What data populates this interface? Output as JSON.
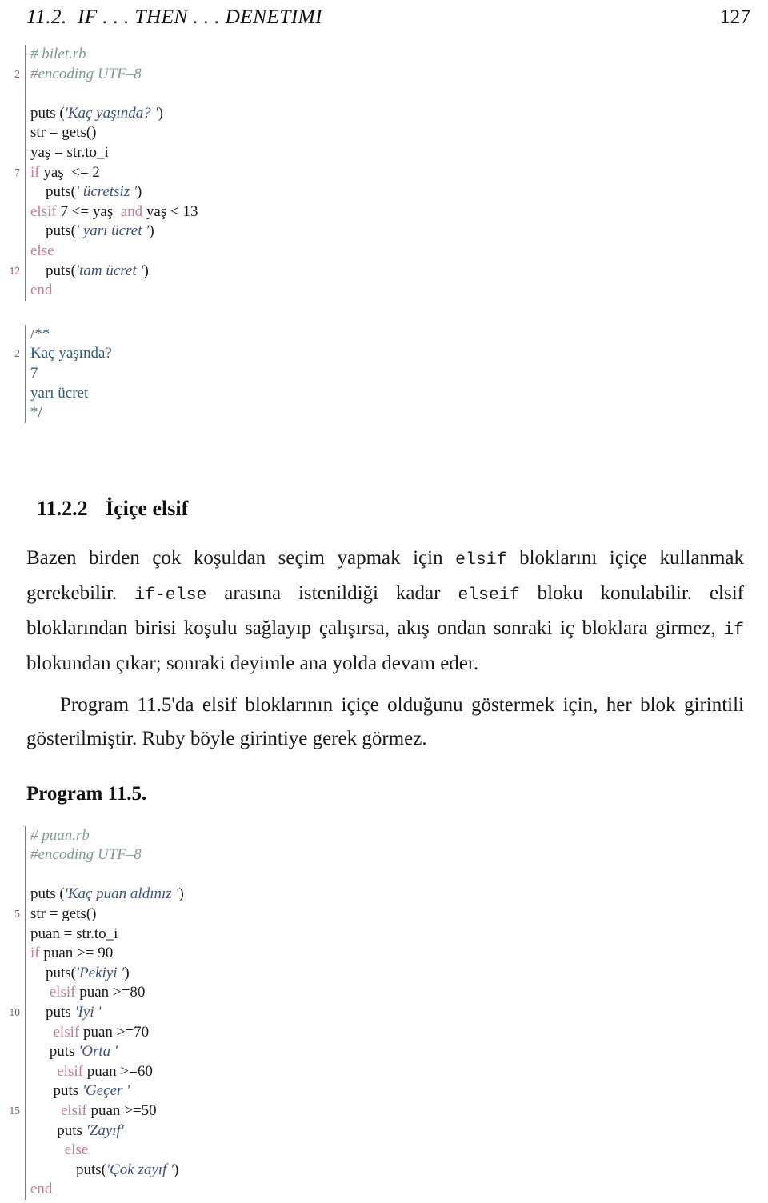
{
  "header": {
    "title": "11.2.  IF . . . THEN . . . DENETIMI",
    "page_number": "127"
  },
  "listing1": {
    "name": "bilet-rb-listing",
    "lines": [
      {
        "no": "",
        "segments": [
          {
            "t": "# bilet.rb",
            "c": "cmt",
            "indent": 0
          }
        ]
      },
      {
        "no": "2",
        "segments": [
          {
            "t": "#encoding UTF–8",
            "c": "cmt",
            "indent": 0
          }
        ]
      },
      {
        "no": "",
        "segments": [
          {
            "t": "",
            "c": "plain",
            "indent": 0
          }
        ]
      },
      {
        "no": "",
        "segments": [
          {
            "t": "puts (",
            "c": "plain",
            "indent": 0
          },
          {
            "t": "'Kaç yaşında? '",
            "c": "str",
            "indent": 0
          },
          {
            "t": ")",
            "c": "plain",
            "indent": 0
          }
        ]
      },
      {
        "no": "",
        "segments": [
          {
            "t": "str = gets()",
            "c": "plain",
            "indent": 0
          }
        ]
      },
      {
        "no": "",
        "segments": [
          {
            "t": "yaş = str.to_i",
            "c": "plain",
            "indent": 0
          }
        ]
      },
      {
        "no": "7",
        "segments": [
          {
            "t": "if",
            "c": "kw",
            "indent": 0
          },
          {
            "t": " yaş  <= 2",
            "c": "plain",
            "indent": 0
          }
        ]
      },
      {
        "no": "",
        "segments": [
          {
            "t": "    puts(",
            "c": "plain",
            "indent": 0
          },
          {
            "t": "' ücretsiz '",
            "c": "str",
            "indent": 0
          },
          {
            "t": ")",
            "c": "plain",
            "indent": 0
          }
        ]
      },
      {
        "no": "",
        "segments": [
          {
            "t": "elsif",
            "c": "kw",
            "indent": 0
          },
          {
            "t": " 7 <= yaş  ",
            "c": "plain",
            "indent": 0
          },
          {
            "t": "and",
            "c": "kw",
            "indent": 0
          },
          {
            "t": " yaş < 13",
            "c": "plain",
            "indent": 0
          }
        ]
      },
      {
        "no": "",
        "segments": [
          {
            "t": "    puts(",
            "c": "plain",
            "indent": 0
          },
          {
            "t": "' yarı ücret '",
            "c": "str",
            "indent": 0
          },
          {
            "t": ")",
            "c": "plain",
            "indent": 0
          }
        ]
      },
      {
        "no": "",
        "segments": [
          {
            "t": "else",
            "c": "kw",
            "indent": 0
          }
        ]
      },
      {
        "no": "12",
        "segments": [
          {
            "t": "    puts(",
            "c": "plain",
            "indent": 0
          },
          {
            "t": "'tam ücret '",
            "c": "str",
            "indent": 0
          },
          {
            "t": ")",
            "c": "plain",
            "indent": 0
          }
        ]
      },
      {
        "no": "",
        "segments": [
          {
            "t": "end",
            "c": "kw",
            "indent": 0
          }
        ]
      }
    ]
  },
  "listing2": {
    "name": "sample-output-listing",
    "lines": [
      {
        "no": "",
        "segments": [
          {
            "t": "/**",
            "c": "out",
            "indent": 0
          }
        ]
      },
      {
        "no": "2",
        "segments": [
          {
            "t": "Kaç yaşında?",
            "c": "out",
            "indent": 0
          }
        ]
      },
      {
        "no": "",
        "segments": [
          {
            "t": "7",
            "c": "out",
            "indent": 0
          }
        ]
      },
      {
        "no": "",
        "segments": [
          {
            "t": "yarı ücret",
            "c": "out",
            "indent": 0
          }
        ]
      },
      {
        "no": "",
        "segments": [
          {
            "t": "*/",
            "c": "out",
            "indent": 0
          }
        ]
      }
    ]
  },
  "section": {
    "number": "11.2.2",
    "title": "İçiçe elsif"
  },
  "paragraph1": {
    "part1": "Bazen birden çok koşuldan seçim yapmak için ",
    "code1": "elsif",
    "part2": " bloklarını içiçe kullanmak gerekebilir. ",
    "code2": "if-else",
    "part3": " arasına istenildiği kadar ",
    "code3": "elseif",
    "part4": " bloku konulabilir. elsif bloklarından birisi koşulu sağlayıp çalışırsa, akış ondan sonraki iç bloklara girmez, ",
    "code4": "if",
    "part5": " blokundan çıkar; sonraki deyimle ana yolda devam eder."
  },
  "paragraph2": {
    "text": "Program 11.5'da elsif bloklarının içiçe olduğunu göstermek için, her blok girintili gösterilmiştir. Ruby böyle girintiye gerek görmez."
  },
  "program_label": "Program 11.5.",
  "listing3": {
    "name": "puan-rb-listing",
    "lines": [
      {
        "no": "",
        "segments": [
          {
            "t": "# puan.rb",
            "c": "cmt",
            "indent": 0
          }
        ]
      },
      {
        "no": "",
        "segments": [
          {
            "t": "#encoding UTF–8",
            "c": "cmt",
            "indent": 0
          }
        ]
      },
      {
        "no": "",
        "segments": [
          {
            "t": "",
            "c": "plain",
            "indent": 0
          }
        ]
      },
      {
        "no": "",
        "segments": [
          {
            "t": "puts (",
            "c": "plain",
            "indent": 0
          },
          {
            "t": "'Kaç puan aldınız '",
            "c": "str",
            "indent": 0
          },
          {
            "t": ")",
            "c": "plain",
            "indent": 0
          }
        ]
      },
      {
        "no": "5",
        "segments": [
          {
            "t": "str = gets()",
            "c": "plain",
            "indent": 0
          }
        ]
      },
      {
        "no": "",
        "segments": [
          {
            "t": "puan = str.to_i",
            "c": "plain",
            "indent": 0
          }
        ]
      },
      {
        "no": "",
        "segments": [
          {
            "t": "if",
            "c": "kw",
            "indent": 0
          },
          {
            "t": " puan >= 90",
            "c": "plain",
            "indent": 0
          }
        ]
      },
      {
        "no": "",
        "segments": [
          {
            "t": "    puts(",
            "c": "plain",
            "indent": 0
          },
          {
            "t": "'Pekiyi '",
            "c": "str",
            "indent": 0
          },
          {
            "t": ")",
            "c": "plain",
            "indent": 0
          }
        ]
      },
      {
        "no": "",
        "segments": [
          {
            "t": "     ",
            "c": "plain",
            "indent": 0
          },
          {
            "t": "elsif",
            "c": "kw",
            "indent": 0
          },
          {
            "t": " puan >=80",
            "c": "plain",
            "indent": 0
          }
        ]
      },
      {
        "no": "10",
        "segments": [
          {
            "t": "    puts ",
            "c": "plain",
            "indent": 0
          },
          {
            "t": "'İyi '",
            "c": "str",
            "indent": 0
          }
        ]
      },
      {
        "no": "",
        "segments": [
          {
            "t": "      ",
            "c": "plain",
            "indent": 0
          },
          {
            "t": "elsif",
            "c": "kw",
            "indent": 0
          },
          {
            "t": " puan >=70",
            "c": "plain",
            "indent": 0
          }
        ]
      },
      {
        "no": "",
        "segments": [
          {
            "t": "     puts ",
            "c": "plain",
            "indent": 0
          },
          {
            "t": "'Orta '",
            "c": "str",
            "indent": 0
          }
        ]
      },
      {
        "no": "",
        "segments": [
          {
            "t": "       ",
            "c": "plain",
            "indent": 0
          },
          {
            "t": "elsif",
            "c": "kw",
            "indent": 0
          },
          {
            "t": " puan >=60",
            "c": "plain",
            "indent": 0
          }
        ]
      },
      {
        "no": "",
        "segments": [
          {
            "t": "      puts ",
            "c": "plain",
            "indent": 0
          },
          {
            "t": "'Geçer '",
            "c": "str",
            "indent": 0
          }
        ]
      },
      {
        "no": "15",
        "segments": [
          {
            "t": "        ",
            "c": "plain",
            "indent": 0
          },
          {
            "t": "elsif",
            "c": "kw",
            "indent": 0
          },
          {
            "t": " puan >=50",
            "c": "plain",
            "indent": 0
          }
        ]
      },
      {
        "no": "",
        "segments": [
          {
            "t": "       puts ",
            "c": "plain",
            "indent": 0
          },
          {
            "t": "'Zayıf'",
            "c": "str",
            "indent": 0
          }
        ]
      },
      {
        "no": "",
        "segments": [
          {
            "t": "         ",
            "c": "plain",
            "indent": 0
          },
          {
            "t": "else",
            "c": "kw",
            "indent": 0
          }
        ]
      },
      {
        "no": "",
        "segments": [
          {
            "t": "            puts(",
            "c": "plain",
            "indent": 0
          },
          {
            "t": "'Çok zayıf '",
            "c": "str",
            "indent": 0
          },
          {
            "t": ")",
            "c": "plain",
            "indent": 0
          }
        ]
      },
      {
        "no": "",
        "segments": [
          {
            "t": "end",
            "c": "kw",
            "indent": 0
          }
        ]
      }
    ]
  },
  "colors": {
    "keyword": "#c07f8c",
    "string": "#3d4f7c",
    "comment": "#7d9a95",
    "output": "#2f5d78",
    "lineno": "#a04a5a",
    "rule": "#7a7a80",
    "text": "#1a1a1a"
  }
}
